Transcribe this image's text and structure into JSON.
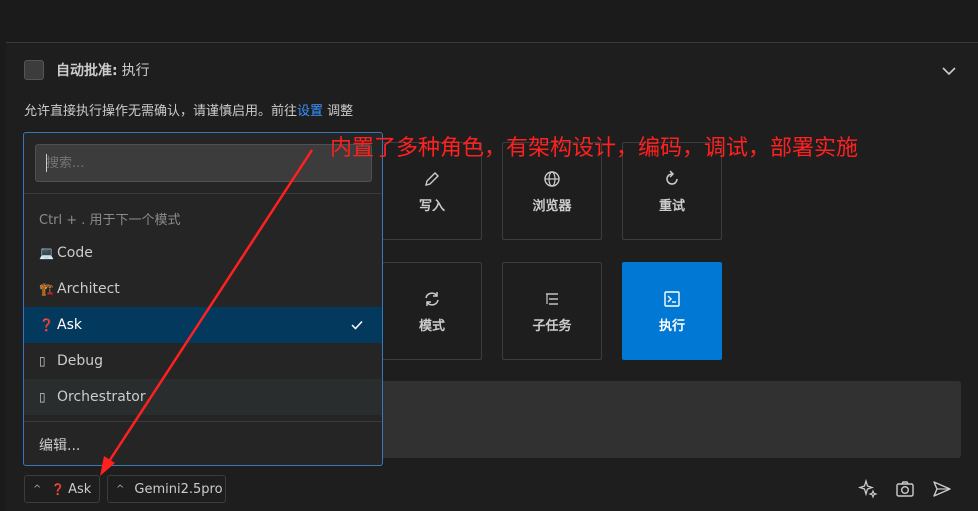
{
  "auto_approve": {
    "label": "自动批准:",
    "value": "执行"
  },
  "description": {
    "prefix": "允许直接执行操作无需确认，请谨慎启用。前往",
    "link": "设置",
    "suffix": "调整"
  },
  "actions": [
    {
      "label": "写入",
      "icon": "pencil-icon"
    },
    {
      "label": "浏览器",
      "icon": "globe-icon"
    },
    {
      "label": "重试",
      "icon": "refresh-icon"
    },
    {
      "label": "模式",
      "icon": "sync-icon"
    },
    {
      "label": "子任务",
      "icon": "list-tree-icon"
    },
    {
      "label": "执行",
      "icon": "terminal-icon"
    }
  ],
  "mode_menu": {
    "search_placeholder": "搜索...",
    "hint": "Ctrl + . 用于下一个模式",
    "items": [
      {
        "emoji": "💻",
        "label": "Code"
      },
      {
        "emoji": "🏗️",
        "label": "Architect"
      },
      {
        "emoji": "❓",
        "label": "Ask"
      },
      {
        "emoji": "▯",
        "label": "Debug"
      },
      {
        "emoji": "▯",
        "label": "Orchestrator"
      }
    ],
    "selected": "Ask",
    "edit_label": "编辑..."
  },
  "bottom_bar": {
    "mode_caret": "^",
    "mode_emoji": "❓",
    "mode_label": "Ask",
    "model_caret": "^",
    "model_label": "Gemini2.5pro"
  },
  "annotation": {
    "text": "内置了多种角色，有架构设计，编码，调试，部署实施",
    "color": "#ff2020"
  },
  "colors": {
    "accent": "#0078d4",
    "link": "#3794ff",
    "selected_bg": "#04395e"
  }
}
